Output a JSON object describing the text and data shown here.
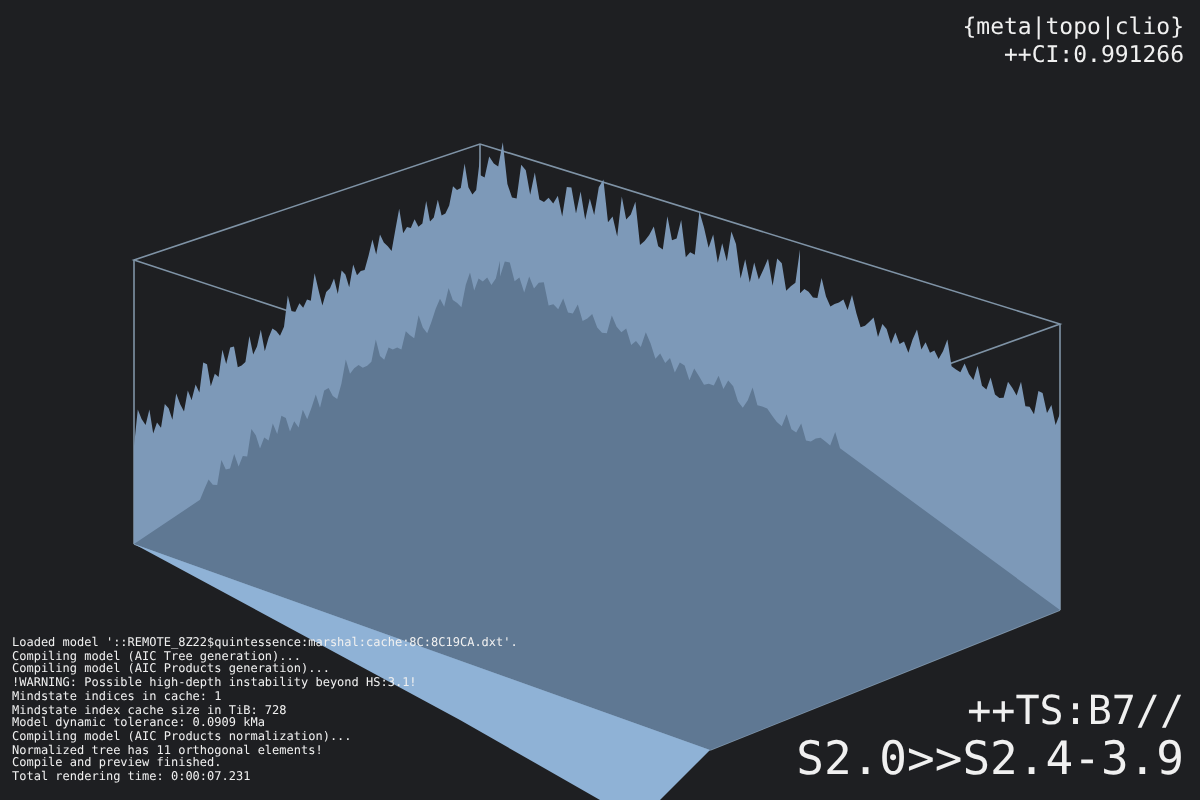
{
  "header": {
    "title": "{meta|topo|clio}",
    "ci": "++CI:0.991266"
  },
  "log": [
    "Loaded model '::REMOTE_8Z22$quintessence:marshal:cache:8C:8C19CA.dxt'.",
    "Compiling model (AIC Tree generation)...",
    "Compiling model (AIC Products generation)...",
    "!WARNING: Possible high-depth instability beyond HS:3.1!",
    "Mindstate indices in cache: 1",
    "Mindstate index cache size in TiB: 728",
    "Model dynamic tolerance: 0.0909 kMa",
    "Compiling model (AIC Products normalization)...",
    "Normalized tree has 11 orthogonal elements!",
    "Compile and preview finished.",
    "Total rendering time: 0:00:07.231"
  ],
  "status": {
    "ts": "++TS:B7//",
    "range": "S2.0>>S2.4-3.9"
  }
}
